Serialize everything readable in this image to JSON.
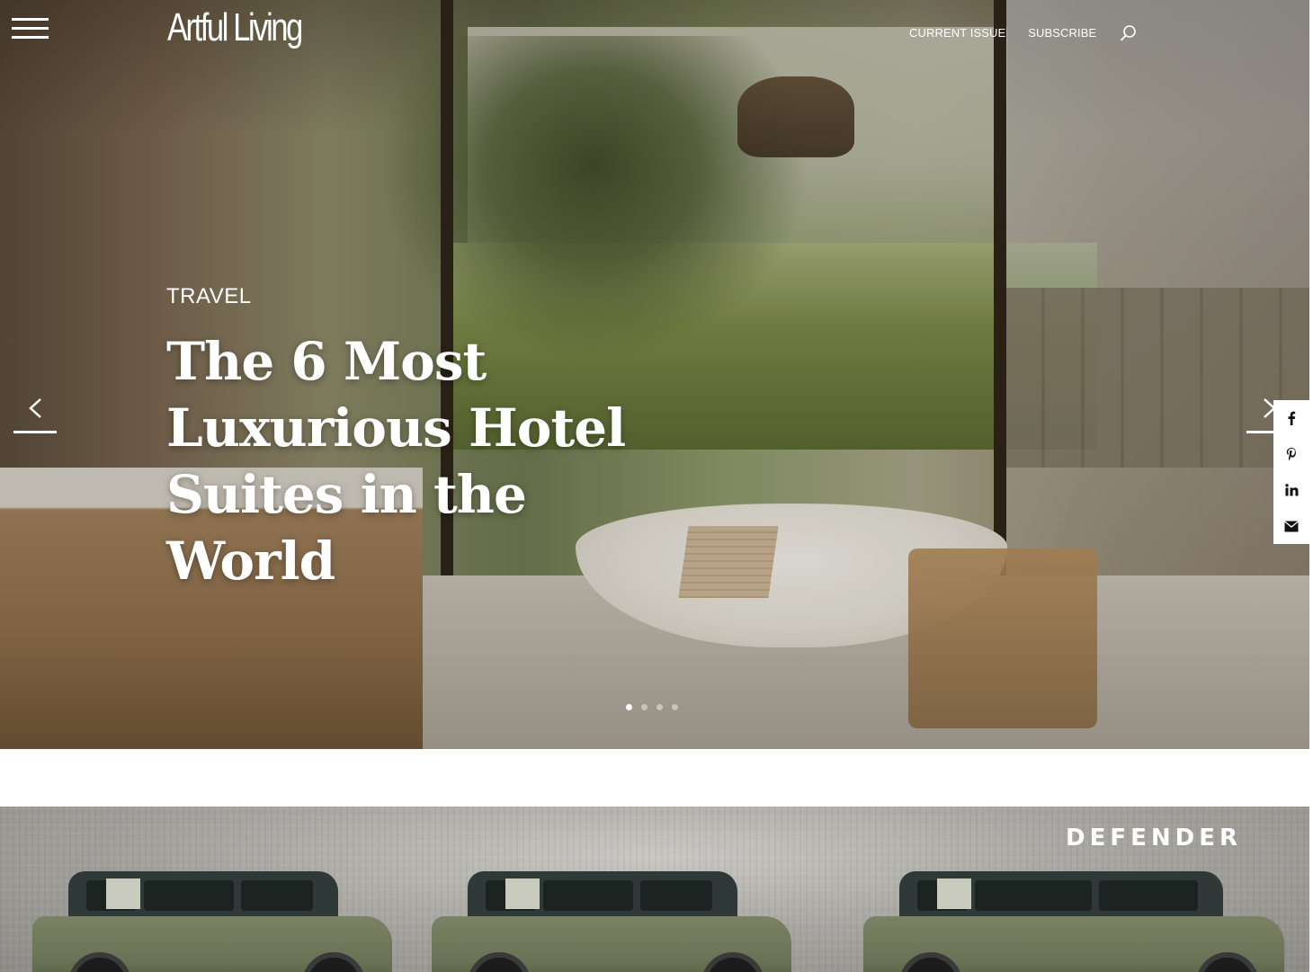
{
  "header": {
    "logo": "Artful Living",
    "nav": [
      "CURRENT ISSUE",
      "SUBSCRIBE"
    ],
    "icons": {
      "menu": "hamburger-menu-icon",
      "search": "search-icon"
    }
  },
  "hero": {
    "category": "TRAVEL",
    "headline": "The 6 Most Luxurious Hotel Suites in the World",
    "slides": {
      "total": 4,
      "active": 1
    },
    "icons": {
      "prev": "chevron-left-icon",
      "next": "chevron-right-icon"
    }
  },
  "share": {
    "items": [
      {
        "name": "facebook",
        "icon": "facebook-icon",
        "glyph": "f"
      },
      {
        "name": "pinterest",
        "icon": "pinterest-icon",
        "glyph": "P"
      },
      {
        "name": "linkedin",
        "icon": "linkedin-icon",
        "glyph": "in"
      },
      {
        "name": "email",
        "icon": "email-icon",
        "glyph": "✉"
      }
    ]
  },
  "ad": {
    "brand": "DEFENDER"
  },
  "colors": {
    "text_on_hero": "#ffffff",
    "share_bg": "#ffffff"
  }
}
